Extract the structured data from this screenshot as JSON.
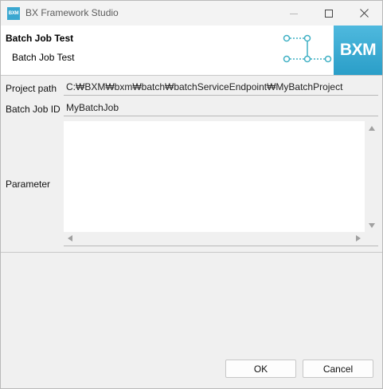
{
  "window": {
    "title": "BX Framework Studio",
    "app_icon_text": "BXM"
  },
  "banner": {
    "title": "Batch Job Test",
    "description": "Batch Job Test",
    "logo_text": "BXM",
    "accent_color": "#3fb0c4",
    "logo_color": "#35a9d4"
  },
  "form": {
    "project_path_label": "Project path",
    "project_path_value": "C:₩BXM₩bxm₩batch₩batchServiceEndpoint₩MyBatchProject",
    "batch_job_id_label": "Batch Job ID",
    "batch_job_id_value": "MyBatchJob",
    "parameter_label": "Parameter",
    "parameter_value": ""
  },
  "buttons": {
    "ok_label": "OK",
    "cancel_label": "Cancel"
  }
}
